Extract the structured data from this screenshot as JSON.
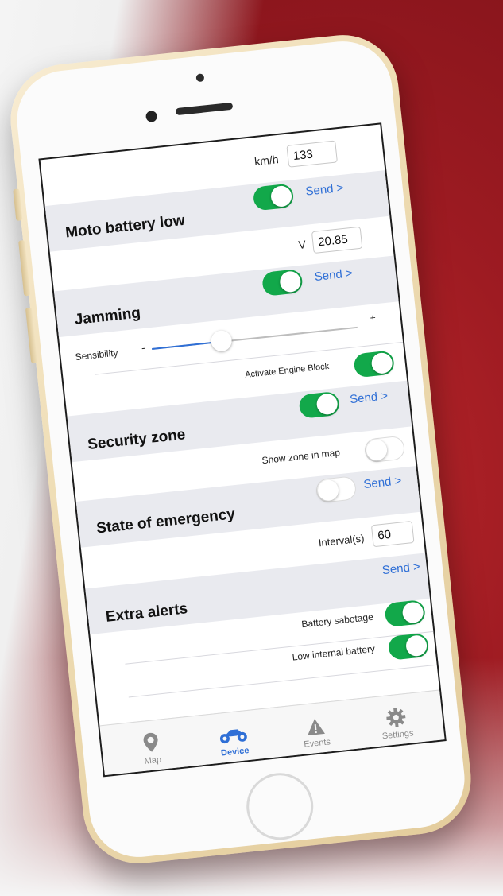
{
  "speed": {
    "unit": "km/h",
    "value": "133"
  },
  "moto_battery": {
    "title": "Moto battery low",
    "send": "Send >",
    "toggle_on": true,
    "unit": "V",
    "value": "20.85"
  },
  "jamming": {
    "title": "Jamming",
    "send": "Send >",
    "toggle_on": true,
    "sensibility_label": "Sensibility",
    "minus": "-",
    "plus": "+",
    "sensibility_level": 0.35,
    "engine_block_label": "Activate Engine Block",
    "engine_block_on": true
  },
  "security_zone": {
    "title": "Security zone",
    "send": "Send >",
    "toggle_on": true,
    "show_zone_label": "Show zone in map",
    "show_zone_on": false
  },
  "emergency": {
    "title": "State of emergency",
    "send": "Send >",
    "toggle_on": false,
    "interval_label": "Interval(s)",
    "interval_value": "60"
  },
  "extra_alerts": {
    "title": "Extra alerts",
    "send": "Send >",
    "battery_sabotage_label": "Battery sabotage",
    "battery_sabotage_on": true,
    "low_internal_label": "Low internal battery",
    "low_internal_on": true
  },
  "tabs": [
    {
      "label": "Map",
      "icon": "map-pin-icon"
    },
    {
      "label": "Device",
      "icon": "motorcycle-icon",
      "active": true
    },
    {
      "label": "Events",
      "icon": "warning-icon"
    },
    {
      "label": "Settings",
      "icon": "gear-icon"
    }
  ],
  "colors": {
    "accent": "#2f6fd6",
    "toggle_on": "#12a84a",
    "section_bg": "#e9eaef"
  }
}
